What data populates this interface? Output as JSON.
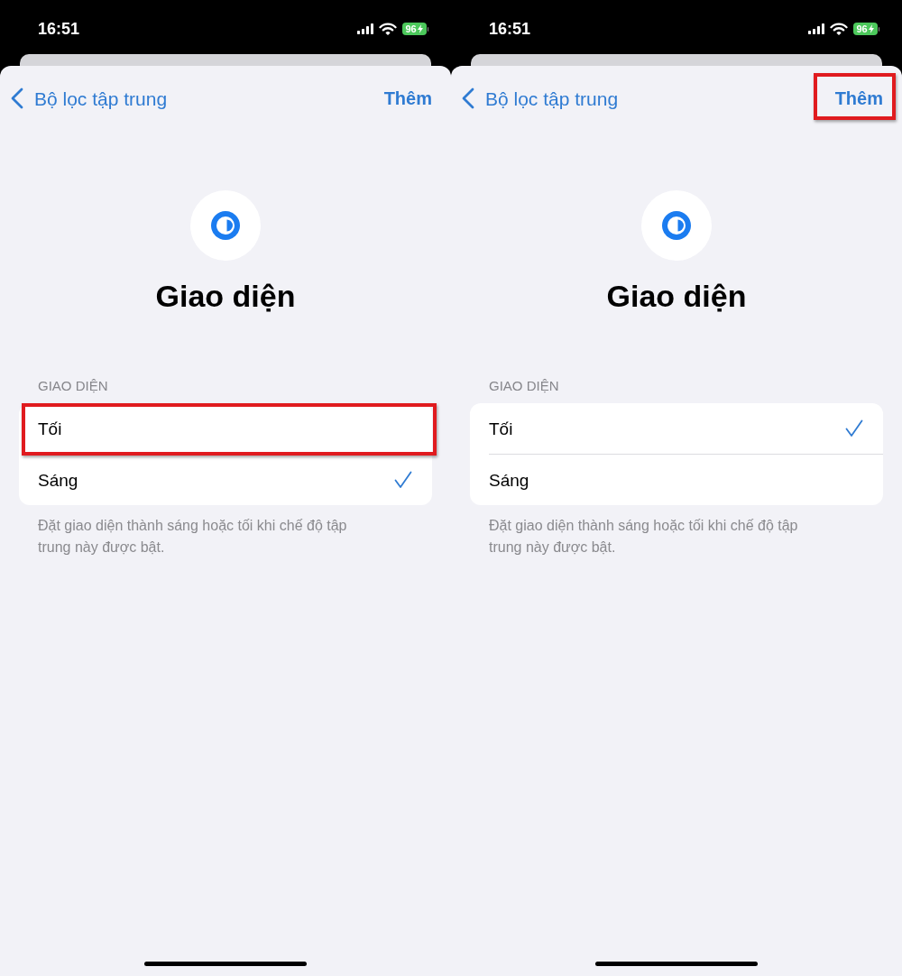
{
  "screens": [
    {
      "status_bar": {
        "time": "16:51",
        "battery": "96"
      },
      "nav": {
        "back": "Bộ lọc tập trung",
        "action": {
          "label": "Thêm",
          "highlighted": false
        }
      },
      "title": "Giao diện",
      "section": {
        "header": "GIAO DIỆN",
        "options": [
          {
            "label": "Tối",
            "selected": false,
            "highlighted": true
          },
          {
            "label": "Sáng",
            "selected": true,
            "highlighted": false
          }
        ],
        "footer": "Đặt giao diện thành sáng hoặc tối khi chế độ tập trung này được bật."
      }
    },
    {
      "status_bar": {
        "time": "16:51",
        "battery": "96"
      },
      "nav": {
        "back": "Bộ lọc tập trung",
        "action": {
          "label": "Thêm",
          "highlighted": true
        }
      },
      "title": "Giao diện",
      "section": {
        "header": "GIAO DIỆN",
        "options": [
          {
            "label": "Tối",
            "selected": true,
            "highlighted": false
          },
          {
            "label": "Sáng",
            "selected": false,
            "highlighted": false
          }
        ],
        "footer": "Đặt giao diện thành sáng hoặc tối khi chế độ tập trung này được bật."
      }
    }
  ]
}
